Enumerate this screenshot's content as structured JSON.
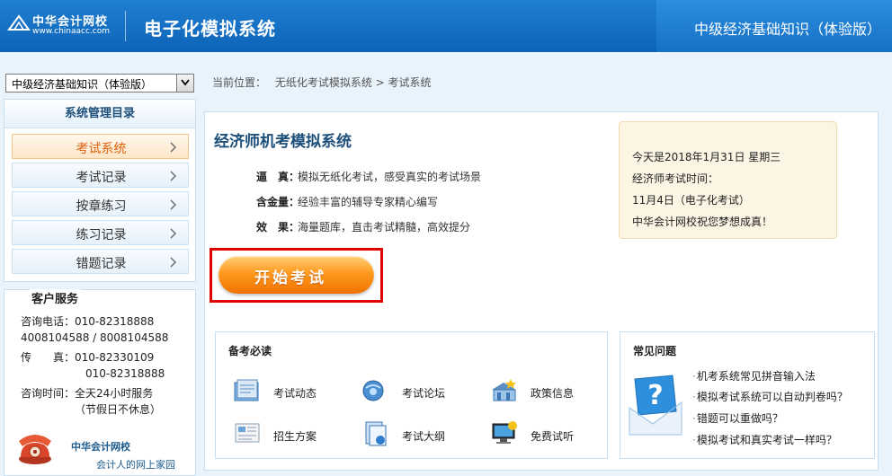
{
  "header": {
    "logo_name": "中华会计网校",
    "logo_url": "www.chinaacc.com",
    "system_title": "电子化模拟系统",
    "course_title": "中级经济基础知识（体验版）"
  },
  "course_select": {
    "value": "中级经济基础知识（体验版）"
  },
  "sidebar": {
    "title": "系统管理目录",
    "items": [
      {
        "label": "考试系统"
      },
      {
        "label": "考试记录"
      },
      {
        "label": "按章练习"
      },
      {
        "label": "练习记录"
      },
      {
        "label": "错题记录"
      }
    ]
  },
  "service": {
    "title": "客户服务",
    "lines": [
      "咨询电话：010-82318888",
      "4008104588 / 8008104588",
      "传　　真：010-82330109",
      "010-82318888",
      "咨询时间：全天24小时服务",
      "（节假日不休息）"
    ],
    "brand": "中华会计网校",
    "slogan": "会计人的网上家园"
  },
  "breadcrumb": {
    "prefix": "当前位置：",
    "path": "无纸化考试模拟系统 > 考试系统"
  },
  "main": {
    "title": "经济师机考模拟系统",
    "features": [
      {
        "key": "逼　真：",
        "text": "模拟无纸化考试，感受真实的考试场景"
      },
      {
        "key": "含金量：",
        "text": "经验丰富的辅导专家精心编写"
      },
      {
        "key": "效　果：",
        "text": "海量题库，直击考试精髓，高效提分"
      }
    ],
    "start_button": "开始考试",
    "notice": [
      "今天是2018年1月31日 星期三",
      "经济师考试时间：",
      "11月4日（电子化考试）",
      "中华会计网校祝您梦想成真！"
    ]
  },
  "prep": {
    "title": "备考必读",
    "items": [
      {
        "label": "考试动态",
        "icon": "news-icon"
      },
      {
        "label": "考试论坛",
        "icon": "forum-icon"
      },
      {
        "label": "政策信息",
        "icon": "policy-icon"
      },
      {
        "label": "招生方案",
        "icon": "enrollment-icon"
      },
      {
        "label": "考试大纲",
        "icon": "syllabus-icon"
      },
      {
        "label": "免费试听",
        "icon": "free-trial-icon"
      }
    ]
  },
  "faq": {
    "title": "常见问题",
    "items": [
      "机考系统常见拼音输入法",
      "模拟考试系统可以自动判卷吗？",
      "错题可以重做吗？",
      "模拟考试和真实考试一样吗？"
    ]
  },
  "colors": {
    "header_blue": "#0d63b8",
    "accent_orange": "#f07200",
    "highlight_red": "#e00000",
    "link_blue": "#1d4f7a"
  }
}
